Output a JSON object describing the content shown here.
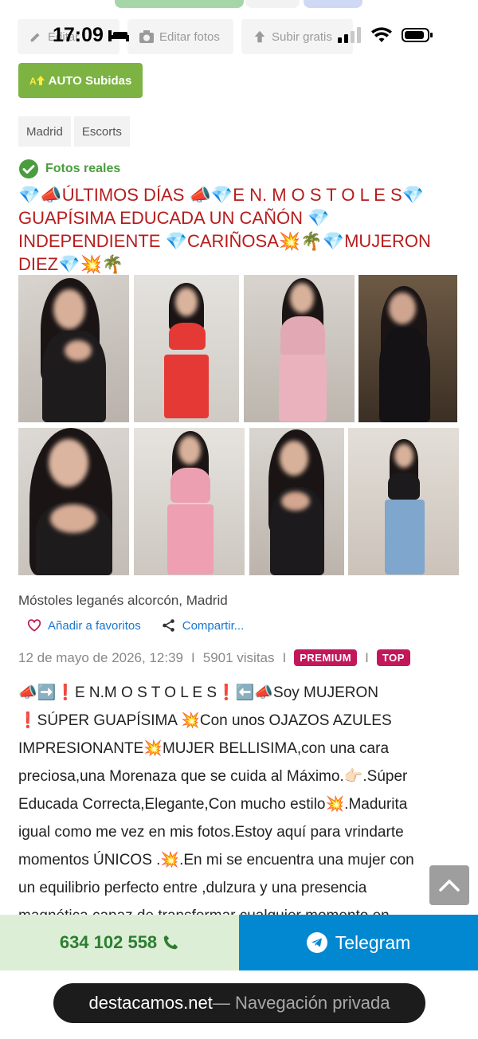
{
  "status_bar": {
    "time": "17:09"
  },
  "toolbar": {
    "edit_label": "Editar",
    "edit_photos_label": "Editar fotos",
    "upload_free_label": "Subir gratis"
  },
  "auto_upload": {
    "label": "AUTO Subidas"
  },
  "tags": [
    "Madrid",
    "Escorts"
  ],
  "verified": {
    "label": "Fotos reales",
    "color": "#4a9d3f"
  },
  "title": "💎📣ÚLTIMOS DÍAS 📣💎E N. M O S T O L E S💎 GUAPÍSIMA EDUCADA UN CAÑÓN 💎 INDEPENDIENTE 💎CARIÑOSA💥🌴💎MUJERON DIEZ💎💥🌴",
  "photos_count": 8,
  "location": "Móstoles leganés alcorcón, Madrid",
  "actions": {
    "favorite_label": "Añadir a favoritos",
    "share_label": "Compartir..."
  },
  "meta": {
    "date": "12 de mayo de 2026, 12:39",
    "separator": "I",
    "visits": "5901 visitas",
    "badge_premium": "PREMIUM",
    "badge_top": "TOP",
    "badge_color": "#c2185b"
  },
  "description": "📣➡️❗E N.M O S T O L E S❗⬅️📣Soy MUJERON ❗SÚPER GUAPÍSIMA 💥Con unos OJAZOS AZULES IMPRESIONANTE💥MUJER BELLISIMA,con una cara preciosa,una Morenaza que se cuida al Máximo.👉🏻.Súper Educada Correcta,Elegante,Con mucho estilo💥.Madurita igual como me vez en mis fotos.Estoy aquí para vrindarte momentos ÚNICOS .💥.En mi se encuentra una mujer con un equilibrio perfecto entre ,dulzura y una presencia magnética capaz de transformar cualquier momento en",
  "contact": {
    "phone": "634 102 558",
    "telegram_label": "Telegram"
  },
  "browser": {
    "domain": "destacamos.net",
    "mode": " — Navegación privada"
  },
  "colors": {
    "title_red": "#b71c1c",
    "link_blue": "#1976d2",
    "phone_green": "#2e7d32",
    "telegram_blue": "#0288d1",
    "auto_green": "#7cb342"
  }
}
